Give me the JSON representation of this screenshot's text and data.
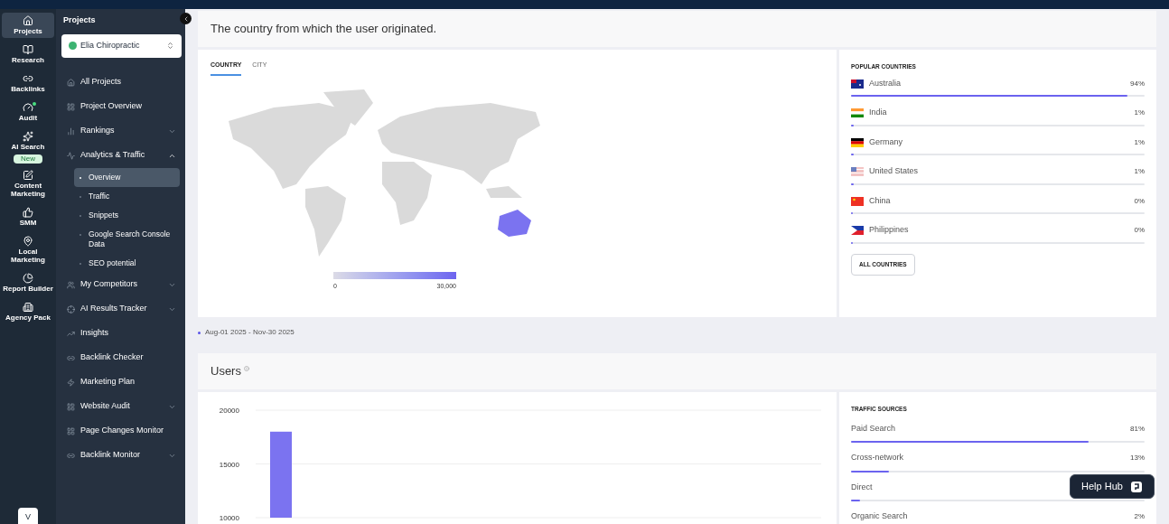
{
  "rail": [
    {
      "label": "Projects",
      "selected": true
    },
    {
      "label": "Research",
      "selected": false
    },
    {
      "label": "Backlinks",
      "selected": false
    },
    {
      "label": "Audit",
      "selected": false,
      "dot": true
    },
    {
      "label": "AI Search",
      "selected": false,
      "badge": "New"
    },
    {
      "label": "Content Marketing",
      "selected": false
    },
    {
      "label": "SMM",
      "selected": false
    },
    {
      "label": "Local Marketing",
      "selected": false
    },
    {
      "label": "Report Builder",
      "selected": false
    },
    {
      "label": "Agency Pack",
      "selected": false
    }
  ],
  "avatar_letter": "V",
  "sidebar": {
    "title": "Projects",
    "project": "Elia Chiropractic",
    "items": [
      {
        "label": "All Projects"
      },
      {
        "label": "Project Overview"
      },
      {
        "label": "Rankings",
        "expanded": false
      },
      {
        "label": "Analytics & Traffic",
        "expanded": true,
        "children": [
          {
            "label": "Overview",
            "selected": true
          },
          {
            "label": "Traffic",
            "selected": false
          },
          {
            "label": "Snippets",
            "selected": false
          },
          {
            "label": "Google Search Console Data",
            "selected": false
          },
          {
            "label": "SEO potential",
            "selected": false
          }
        ]
      },
      {
        "label": "My Competitors",
        "expanded": false
      },
      {
        "label": "AI Results Tracker",
        "expanded": false
      },
      {
        "label": "Insights"
      },
      {
        "label": "Backlink Checker"
      },
      {
        "label": "Marketing Plan"
      },
      {
        "label": "Website Audit",
        "expanded": false
      },
      {
        "label": "Page Changes Monitor"
      },
      {
        "label": "Backlink Monitor",
        "expanded": false
      }
    ]
  },
  "geo_card": {
    "title": "The country from which the user originated.",
    "tabs": [
      {
        "label": "COUNTRY",
        "selected": true
      },
      {
        "label": "CITY",
        "selected": false
      }
    ],
    "legend": {
      "min": "0",
      "max": "30,000"
    },
    "popular_title": "POPULAR COUNTRIES",
    "countries": [
      {
        "name": "Australia",
        "reading": "94%",
        "level": 0.94
      },
      {
        "name": "India",
        "reading": "1%",
        "level": 0.01
      },
      {
        "name": "Germany",
        "reading": "1%",
        "level": 0.01
      },
      {
        "name": "United States",
        "reading": "1%",
        "level": 0.01
      },
      {
        "name": "China",
        "reading": "0%",
        "level": 0.004
      },
      {
        "name": "Philippines",
        "reading": "0%",
        "level": 0.004
      }
    ],
    "all_button": "ALL COUNTRIES"
  },
  "date_range": "Aug-01 2025 - Nov-30 2025",
  "users_card": {
    "title": "Users",
    "chart_data": {
      "type": "bar",
      "values": [
        18000
      ],
      "ylim": [
        10000,
        20000
      ],
      "yticks": [
        10000,
        15000,
        20000
      ]
    },
    "sources_title": "TRAFFIC SOURCES",
    "sources": [
      {
        "name": "Paid Search",
        "reading": "81%",
        "level": 0.81
      },
      {
        "name": "Cross-network",
        "reading": "13%",
        "level": 0.13
      },
      {
        "name": "Direct",
        "level": 0.03
      },
      {
        "name": "Organic Search",
        "reading": "2%"
      }
    ]
  },
  "help_hub": "Help Hub"
}
